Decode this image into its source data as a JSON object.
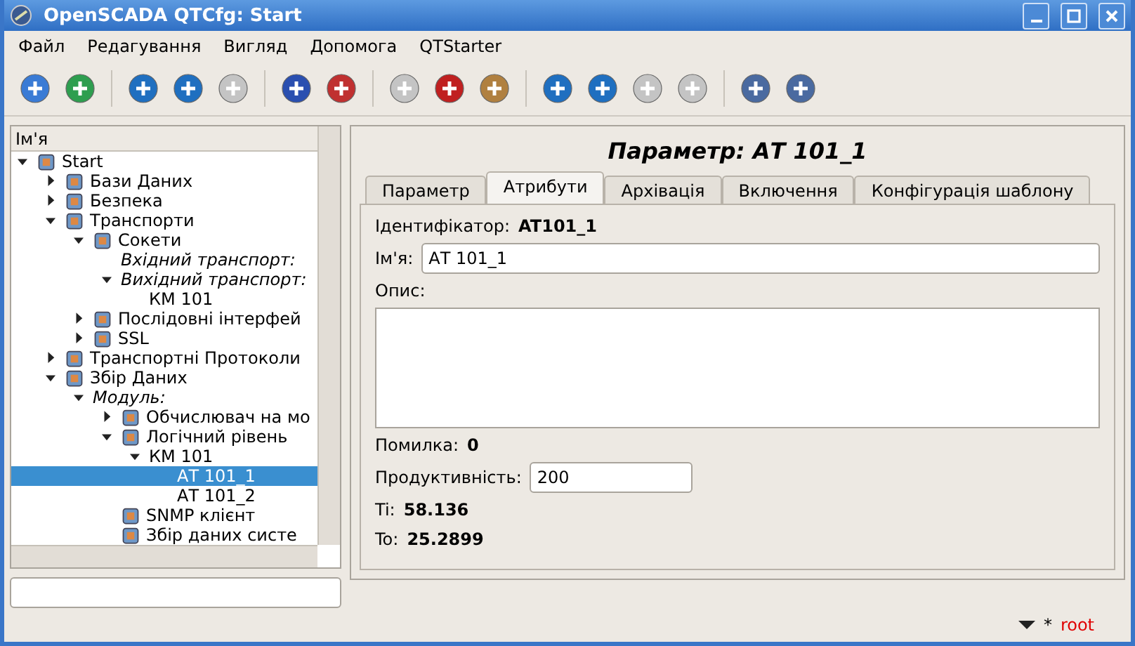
{
  "window": {
    "title": "OpenSCADA QTCfg: Start"
  },
  "menu": [
    "Файл",
    "Редагування",
    "Вигляд",
    "Допомога",
    "QTStarter"
  ],
  "toolbar": [
    [
      {
        "disabled": false
      },
      {
        "disabled": false
      }
    ],
    [
      {
        "disabled": false
      },
      {
        "disabled": false
      },
      {
        "disabled": true
      }
    ],
    [
      {
        "disabled": false
      },
      {
        "disabled": false
      }
    ],
    [
      {
        "disabled": true
      },
      {
        "disabled": false
      },
      {
        "disabled": false
      }
    ],
    [
      {
        "disabled": false
      },
      {
        "disabled": false
      },
      {
        "disabled": true
      },
      {
        "disabled": true
      }
    ],
    [
      {
        "disabled": false
      },
      {
        "disabled": false
      }
    ]
  ],
  "tree": {
    "header": "Ім'я",
    "items": [
      {
        "label": "Start",
        "kind": "item",
        "expanded": true,
        "selected": false,
        "children": [
          {
            "label": "Бази Даних",
            "kind": "item",
            "expanded": false,
            "selected": false
          },
          {
            "label": "Безпека",
            "kind": "item",
            "expanded": false,
            "selected": false
          },
          {
            "label": "Транспорти",
            "kind": "item",
            "expanded": true,
            "selected": false,
            "children": [
              {
                "label": "Сокети",
                "kind": "item",
                "expanded": true,
                "selected": false,
                "children": [
                  {
                    "label": "Вхідний транспорт:",
                    "kind": "group",
                    "selected": false
                  },
                  {
                    "label": "Вихідний транспорт:",
                    "kind": "group",
                    "expanded": true,
                    "selected": false,
                    "children": [
                      {
                        "label": "КМ 101",
                        "kind": "plain",
                        "selected": false
                      }
                    ]
                  }
                ]
              },
              {
                "label": "Послідовні інтерфей",
                "kind": "item",
                "expanded": false,
                "selected": false
              },
              {
                "label": "SSL",
                "kind": "item",
                "expanded": false,
                "selected": false
              }
            ]
          },
          {
            "label": "Транспортні Протоколи",
            "kind": "item",
            "expanded": false,
            "selected": false
          },
          {
            "label": "Збір Даних",
            "kind": "item",
            "expanded": true,
            "selected": false,
            "children": [
              {
                "label": "Модуль:",
                "kind": "group",
                "expanded": true,
                "selected": false,
                "children": [
                  {
                    "label": "Обчислювач на мо",
                    "kind": "item",
                    "expanded": false,
                    "selected": false
                  },
                  {
                    "label": "Логічний рівень",
                    "kind": "item",
                    "expanded": true,
                    "selected": false,
                    "children": [
                      {
                        "label": "КМ 101",
                        "kind": "plain",
                        "expanded": true,
                        "selected": false,
                        "children": [
                          {
                            "label": "АТ 101_1",
                            "kind": "plain",
                            "selected": true
                          },
                          {
                            "label": "АТ 101_2",
                            "kind": "plain",
                            "selected": false
                          }
                        ]
                      }
                    ]
                  },
                  {
                    "label": "SNMP клієнт",
                    "kind": "item",
                    "selected": false
                  },
                  {
                    "label": "Збір даних систе",
                    "kind": "item",
                    "selected": false
                  }
                ]
              }
            ]
          }
        ]
      }
    ]
  },
  "title": "Параметр: АТ 101_1",
  "tabs": [
    {
      "label": "Параметр",
      "selected": false
    },
    {
      "label": "Атрибути",
      "selected": true
    },
    {
      "label": "Архівація",
      "selected": false
    },
    {
      "label": "Включення",
      "selected": false
    },
    {
      "label": "Конфігурація шаблону",
      "selected": false
    }
  ],
  "fields": [
    {
      "kind": "info",
      "label": "Ідентифікатор:",
      "value": "AT101_1"
    },
    {
      "kind": "input",
      "label": "Ім'я:",
      "value": "АТ 101_1"
    },
    {
      "kind": "textarea",
      "label": "Опис:"
    },
    {
      "kind": "info",
      "label": "Помилка:",
      "value": "0"
    },
    {
      "kind": "short",
      "label": "Продуктивність:",
      "value": "200"
    },
    {
      "kind": "info",
      "label": "Ti:",
      "value": "58.136"
    },
    {
      "kind": "info",
      "label": "To:",
      "value": "25.2899"
    }
  ],
  "status_bar": {
    "marker": "*",
    "user": "root"
  }
}
